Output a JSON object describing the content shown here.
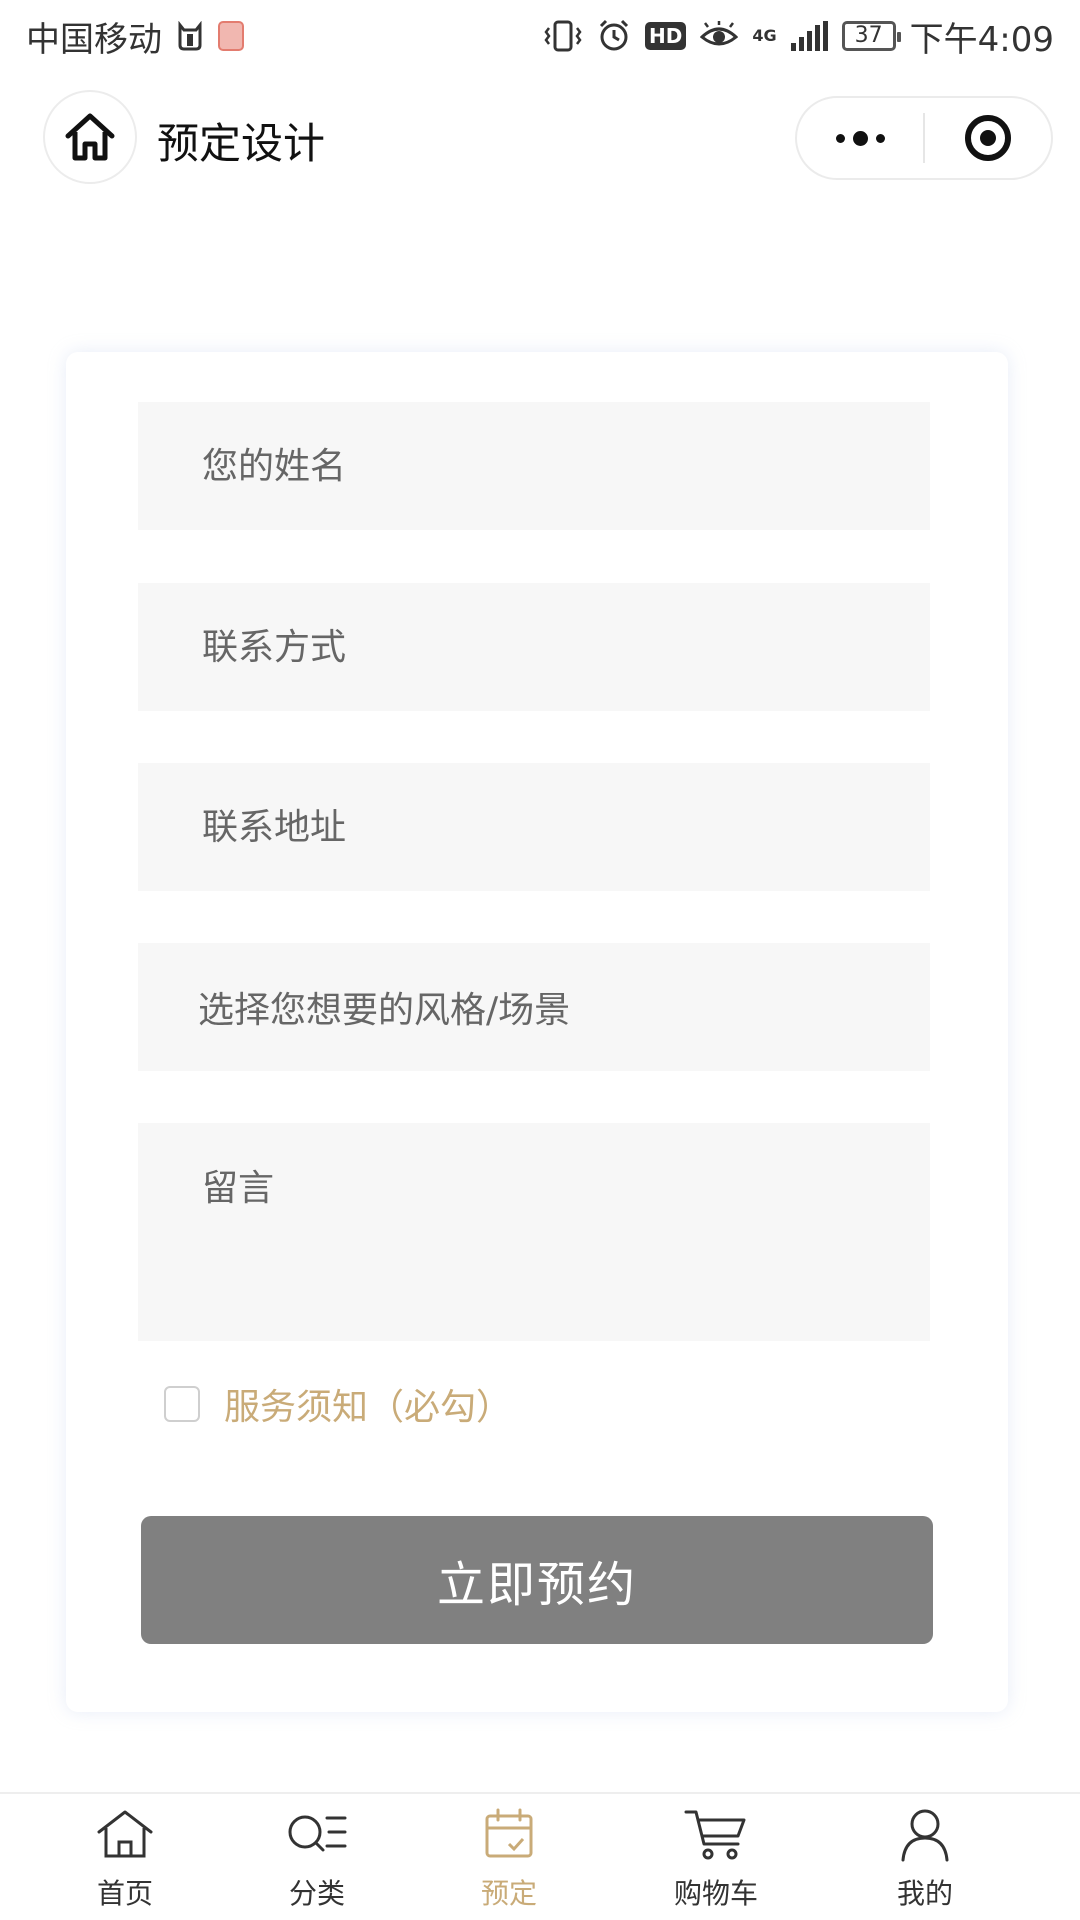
{
  "status_bar": {
    "carrier": "中国移动",
    "hd": "HD",
    "network": "4G",
    "battery": "37",
    "time": "下午4:09"
  },
  "header": {
    "title": "预定设计"
  },
  "form": {
    "name_placeholder": "您的姓名",
    "contact_placeholder": "联系方式",
    "address_placeholder": "联系地址",
    "style_select_label": "选择您想要的风格/场景",
    "message_placeholder": "留言",
    "notice_label": "服务须知（必勾）",
    "notice_checked": false,
    "submit_label": "立即预约"
  },
  "tabs": [
    {
      "label": "首页",
      "icon": "home-icon",
      "active": false
    },
    {
      "label": "分类",
      "icon": "category-search-icon",
      "active": false
    },
    {
      "label": "预定",
      "icon": "calendar-icon",
      "active": true
    },
    {
      "label": "购物车",
      "icon": "cart-icon",
      "active": false
    },
    {
      "label": "我的",
      "icon": "user-icon",
      "active": false
    }
  ],
  "colors": {
    "accent_gold": "#c9ab78",
    "button_gray": "#808080",
    "field_bg": "#f7f7f7"
  }
}
